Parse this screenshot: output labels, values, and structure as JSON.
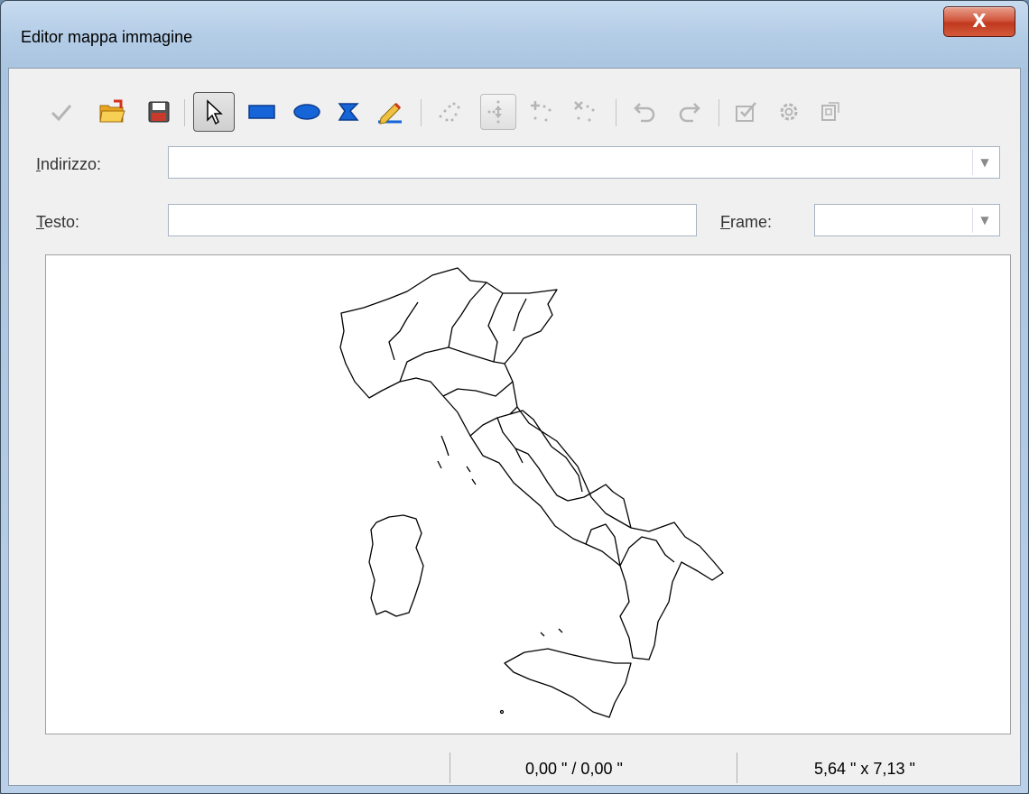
{
  "window": {
    "title": "Editor mappa immagine",
    "close_label": "X"
  },
  "toolbar": {
    "buttons": [
      {
        "icon": "apply-checkmark-icon",
        "enabled": false
      },
      {
        "icon": "open-folder-icon",
        "enabled": true
      },
      {
        "icon": "save-floppy-icon",
        "enabled": true
      },
      {
        "icon": "select-pointer-icon",
        "enabled": true,
        "pressed": true
      },
      {
        "icon": "rectangle-icon",
        "enabled": true
      },
      {
        "icon": "ellipse-icon",
        "enabled": true
      },
      {
        "icon": "polygon-icon",
        "enabled": true
      },
      {
        "icon": "freeform-polygon-icon",
        "enabled": true
      },
      {
        "icon": "edit-points-icon",
        "enabled": false
      },
      {
        "icon": "move-points-icon",
        "enabled": false,
        "pressed": true
      },
      {
        "icon": "insert-points-icon",
        "enabled": false
      },
      {
        "icon": "delete-points-icon",
        "enabled": false
      },
      {
        "icon": "undo-icon",
        "enabled": false
      },
      {
        "icon": "redo-icon",
        "enabled": false
      },
      {
        "icon": "active-icon",
        "enabled": false
      },
      {
        "icon": "macro-icon",
        "enabled": false
      },
      {
        "icon": "properties-icon",
        "enabled": false
      }
    ]
  },
  "fields": {
    "address": {
      "label_accel": "I",
      "label_rest": "ndirizzo:",
      "value": ""
    },
    "text": {
      "label_accel": "T",
      "label_rest": "esto:",
      "value": ""
    },
    "frame": {
      "label_accel": "F",
      "label_rest": "rame:",
      "value": ""
    }
  },
  "status": {
    "position": "0,00 \" / 0,00 \"",
    "size": "5,64 \" x 7,13 \""
  },
  "colors": {
    "accent_blue": "#1565d8",
    "disabled_gray": "#9a9a9a",
    "close_red": "#c1391f"
  }
}
